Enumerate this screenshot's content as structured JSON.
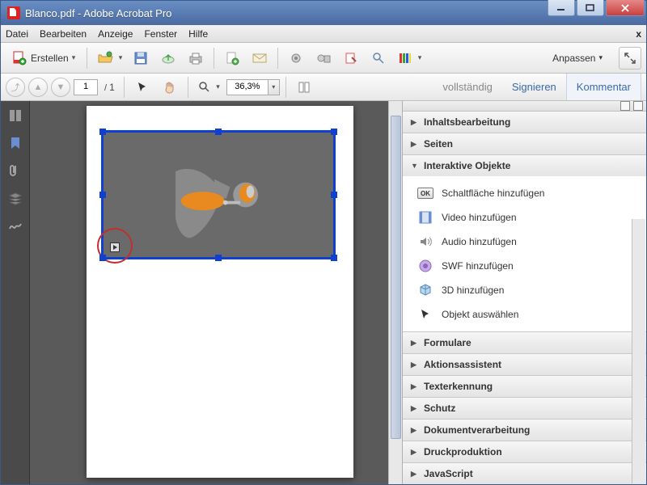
{
  "title": "Blanco.pdf - Adobe Acrobat Pro",
  "menu": {
    "datei": "Datei",
    "bearbeiten": "Bearbeiten",
    "anzeige": "Anzeige",
    "fenster": "Fenster",
    "hilfe": "Hilfe"
  },
  "toolbar": {
    "erstellen": "Erstellen",
    "anpassen": "Anpassen"
  },
  "nav": {
    "page": "1",
    "total": "1",
    "zoom": "36,3%"
  },
  "tabs": {
    "vollstaendig": "vollständig",
    "signieren": "Signieren",
    "kommentar": "Kommentar"
  },
  "panels": {
    "inhalt": "Inhaltsbearbeitung",
    "seiten": "Seiten",
    "interaktiv": "Interaktive Objekte",
    "formulare": "Formulare",
    "aktion": "Aktionsassistent",
    "text": "Texterkennung",
    "schutz": "Schutz",
    "dokument": "Dokumentverarbeitung",
    "druck": "Druckproduktion",
    "js": "JavaScript"
  },
  "tools": {
    "ok": "OK",
    "button": "Schaltfläche hinzufügen",
    "video": "Video hinzufügen",
    "audio": "Audio hinzufügen",
    "swf": "SWF hinzufügen",
    "3d": "3D hinzufügen",
    "select": "Objekt auswählen"
  }
}
